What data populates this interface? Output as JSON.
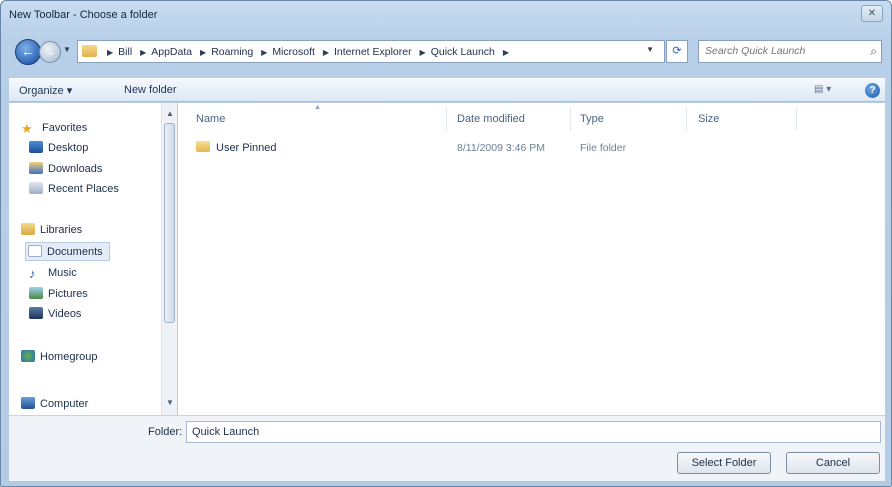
{
  "window": {
    "title": "New Toolbar - Choose a folder",
    "close_glyph": "✕"
  },
  "address": {
    "crumbs": [
      "Bill",
      "AppData",
      "Roaming",
      "Microsoft",
      "Internet Explorer",
      "Quick Launch"
    ],
    "search_placeholder": "Search Quick Launch"
  },
  "toolbar": {
    "organize_label": "Organize ▾",
    "new_folder_label": "New folder",
    "view_label": "▤ ▾",
    "help_glyph": "?"
  },
  "nav": {
    "favorites": "Favorites",
    "desktop": "Desktop",
    "downloads": "Downloads",
    "recent": "Recent Places",
    "libraries": "Libraries",
    "documents": "Documents",
    "music": "Music",
    "pictures": "Pictures",
    "videos": "Videos",
    "homegroup": "Homegroup",
    "computer": "Computer"
  },
  "columns": {
    "name": "Name",
    "date": "Date modified",
    "type": "Type",
    "size": "Size"
  },
  "files": [
    {
      "name": "User Pinned",
      "date": "8/11/2009 3:46 PM",
      "type": "File folder",
      "size": ""
    }
  ],
  "footer": {
    "folder_label": "Folder:",
    "folder_value": "Quick Launch",
    "select_label": "Select Folder",
    "cancel_label": "Cancel"
  },
  "colors": {
    "title_bg": "#c9dcf0",
    "accent": "#2d66b5",
    "folder": "#e5b651"
  }
}
